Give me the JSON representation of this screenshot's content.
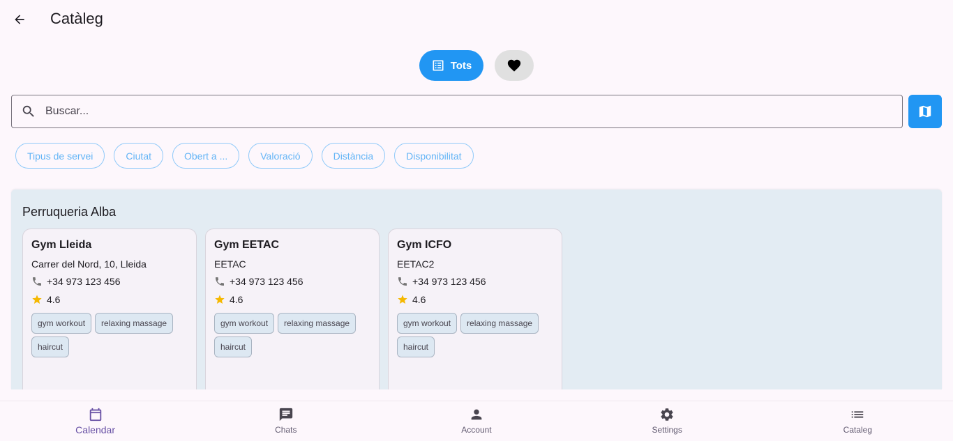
{
  "app": {
    "title": "Catàleg"
  },
  "toggle": {
    "all_label": "Tots"
  },
  "search": {
    "placeholder": "Buscar..."
  },
  "filters": [
    "Tipus de servei",
    "Ciutat",
    "Obert a ...",
    "Valoració",
    "Distància",
    "Disponibilitat"
  ],
  "section": {
    "title": "Perruqueria Alba",
    "cards": [
      {
        "name": "Gym Lleida",
        "address": "Carrer del Nord, 10, Lleida",
        "phone": "+34 973 123 456",
        "rating": "4.6",
        "tags": [
          "gym workout",
          "relaxing massage",
          "haircut"
        ]
      },
      {
        "name": "Gym EETAC",
        "address": "EETAC",
        "phone": "+34 973 123 456",
        "rating": "4.6",
        "tags": [
          "gym workout",
          "relaxing massage",
          "haircut"
        ]
      },
      {
        "name": "Gym ICFO",
        "address": "EETAC2",
        "phone": "+34 973 123 456",
        "rating": "4.6",
        "tags": [
          "gym workout",
          "relaxing massage",
          "haircut"
        ]
      }
    ]
  },
  "nav": [
    {
      "label": "Calendar",
      "icon": "calendar-icon",
      "active": true
    },
    {
      "label": "Chats",
      "icon": "chat-icon",
      "active": false
    },
    {
      "label": "Account",
      "icon": "person-icon",
      "active": false
    },
    {
      "label": "Settings",
      "icon": "gear-icon",
      "active": false
    },
    {
      "label": "Cataleg",
      "icon": "list-icon",
      "active": false
    }
  ],
  "colors": {
    "accent": "#2196f3",
    "nav_active": "#6750a4",
    "star": "#f5b800",
    "section_bg": "#e3ecf3"
  }
}
